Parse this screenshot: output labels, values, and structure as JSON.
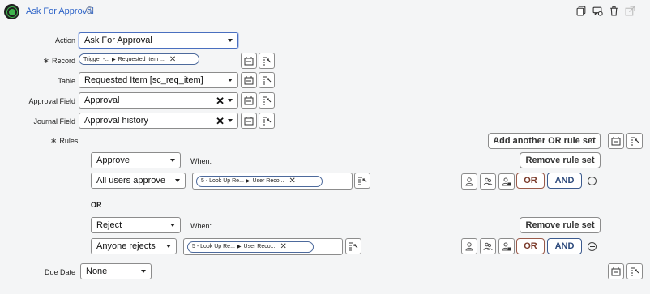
{
  "header": {
    "title": "Ask For Approval",
    "help_glyph": "?",
    "icons": [
      "copy-icon",
      "comment-icon",
      "trash-icon",
      "open-external-icon"
    ]
  },
  "form": {
    "action": {
      "label": "Action",
      "value": "Ask For Approval"
    },
    "record": {
      "label": "Record",
      "required_marker": "∗",
      "pill_part1": "Trigger -...",
      "pill_part2": "Requested Item ..."
    },
    "table": {
      "label": "Table",
      "value": "Requested Item [sc_req_item]"
    },
    "approval_field": {
      "label": "Approval Field",
      "value": "Approval"
    },
    "journal_field": {
      "label": "Journal Field",
      "value": "Approval history"
    },
    "rules_label": "Rules",
    "add_or_rule_set": "Add another OR rule set",
    "rule_sets": [
      {
        "action": "Approve",
        "when_label": "When:",
        "condition": "All users approve",
        "pill_part1": "5 - Look Up Re...",
        "pill_part2": "User Reco...",
        "remove_label": "Remove rule set",
        "or_label": "OR",
        "and_label": "AND"
      },
      {
        "action": "Reject",
        "when_label": "When:",
        "condition": "Anyone rejects",
        "pill_part1": "5 - Look Up Re...",
        "pill_part2": "User Reco...",
        "remove_label": "Remove rule set",
        "or_label": "OR",
        "and_label": "AND"
      }
    ],
    "or_separator": "OR",
    "due_date": {
      "label": "Due Date",
      "value": "None"
    }
  },
  "colors": {
    "link_blue": "#2d63c8",
    "or_brown": "#7a3a2a",
    "and_blue": "#2d4a7c",
    "logo_green": "#3fb54d"
  }
}
